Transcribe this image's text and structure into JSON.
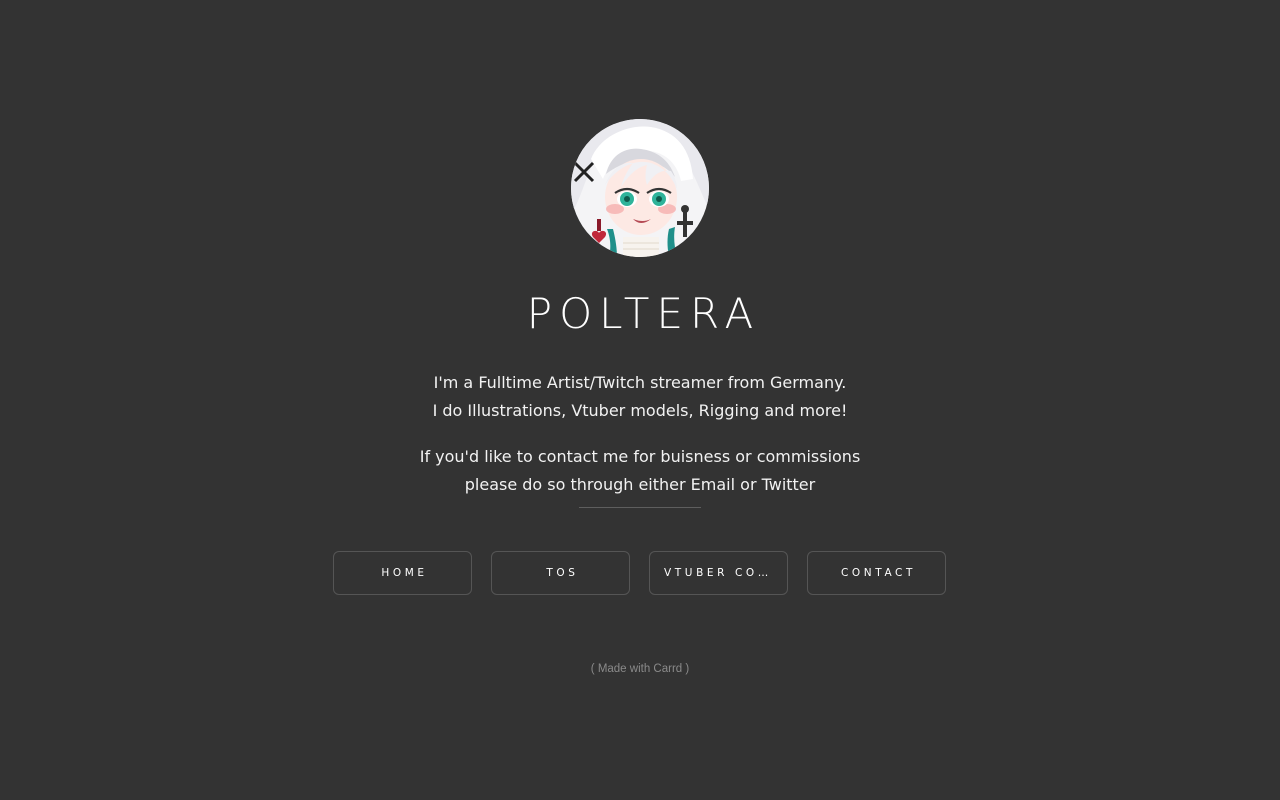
{
  "profile": {
    "avatar_icon": "anime-avatar-portrait",
    "name": "POLTERA"
  },
  "bio": {
    "line1": "I'm a Fulltime Artist/Twitch streamer from Germany.",
    "line2": "I do Illustrations, Vtuber models, Rigging and more!",
    "line3": "If you'd like to contact me for buisness or commissions",
    "line4": "please do so through either Email or Twitter"
  },
  "nav": {
    "buttons": [
      {
        "label": "HOME"
      },
      {
        "label": "TOS"
      },
      {
        "label": "VTUBER COMMISSIONS"
      },
      {
        "label": "CONTACT"
      }
    ]
  },
  "footer": {
    "open": "( ",
    "link": "Made with Carrd",
    "close": " )"
  },
  "colors": {
    "background": "#333333",
    "text": "#ffffff",
    "button_border": "#555555",
    "muted": "#8a8a8a"
  }
}
